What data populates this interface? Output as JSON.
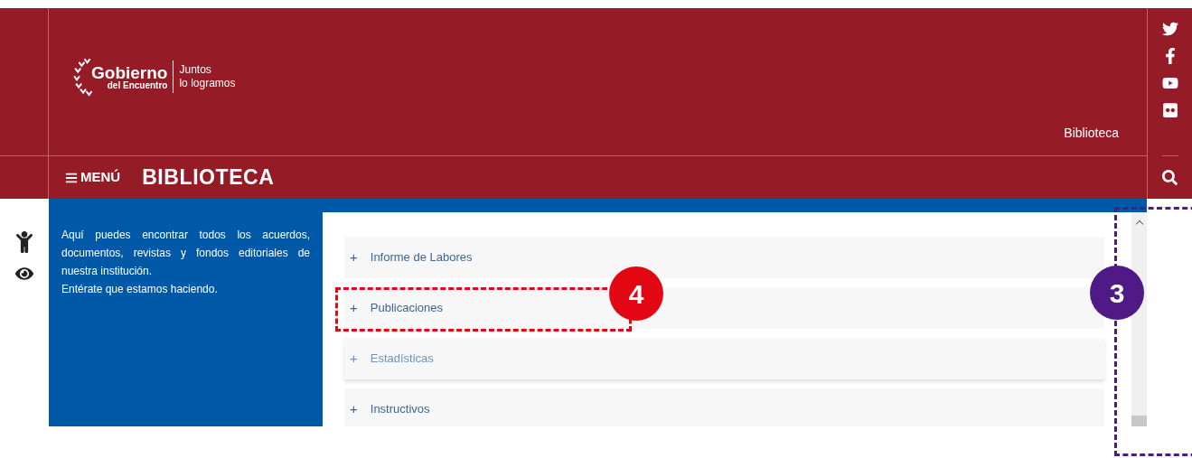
{
  "header": {
    "logo": {
      "name": "Gobierno",
      "subname": "del Encuentro",
      "slogan_1": "Juntos",
      "slogan_2": "lo logramos"
    },
    "breadcrumb": "Biblioteca",
    "menu_label": "MENÚ",
    "page_title": "BIBLIOTECA"
  },
  "intro": {
    "text": "Aquí puedes encontrar todos los acuerdos, documentos, revistas y fondos editoriales de nuestra institución.",
    "subtext": "Entérate que estamos haciendo."
  },
  "accordion": [
    {
      "icon": "+",
      "label": "Informe de Labores",
      "highlighted": false
    },
    {
      "icon": "+",
      "label": "Publicaciones",
      "highlighted": false
    },
    {
      "icon": "+",
      "label": "Estadísticas",
      "highlighted": true
    },
    {
      "icon": "+",
      "label": "Instructivos",
      "highlighted": false
    }
  ],
  "annotations": [
    {
      "number": "4",
      "color": "#e30613"
    },
    {
      "number": "3",
      "color": "#4f1a85"
    }
  ]
}
